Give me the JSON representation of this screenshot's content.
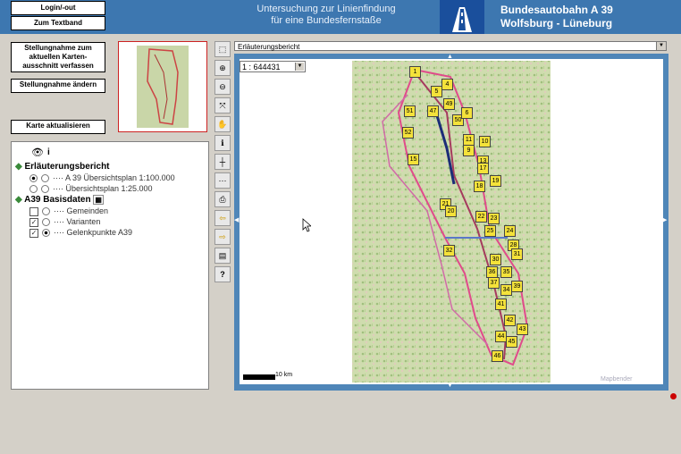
{
  "header": {
    "login_label": "Login/-out",
    "textband_label": "Zum Textband",
    "subtitle_line1": "Untersuchung zur Linienfindung",
    "subtitle_line2": "für eine Bundesfernstaße",
    "title_line1": "Bundesautobahn A 39",
    "title_line2": "Wolfsburg - Lüneburg"
  },
  "left": {
    "stellungnahme_verfassen": "Stellungnahme zum aktuellen Karten- ausschnitt verfassen",
    "stellungnahme_aendern": "Stellungnahme ändern",
    "karte_aktualisieren": "Karte aktualisieren"
  },
  "layers": {
    "group1": "Erläuterungsbericht",
    "item1": "A 39 Übersichtsplan 1:100.000",
    "item2": "Übersichtsplan 1:25.000",
    "group2": "A39 Basisdaten",
    "item3": "Gemeinden",
    "item4": "Varianten",
    "item5": "Gelenkpunkte A39"
  },
  "map": {
    "dropdown": "Erläuterungsbericht",
    "scale": "1 : 644431",
    "scalebar": "10 km",
    "credit": "Mapbender",
    "labels": [
      "1",
      "4",
      "5",
      "49",
      "47",
      "50",
      "51",
      "52",
      "6",
      "11",
      "10",
      "9",
      "13",
      "17",
      "15",
      "18",
      "19",
      "21",
      "20",
      "22",
      "23",
      "25",
      "24",
      "28",
      "31",
      "30",
      "32",
      "36",
      "35",
      "37",
      "34",
      "39",
      "41",
      "42",
      "43",
      "44",
      "45",
      "46"
    ]
  },
  "colors": {
    "header": "#3d77b0",
    "frame": "#4f86b8",
    "label": "#f4e23a"
  }
}
